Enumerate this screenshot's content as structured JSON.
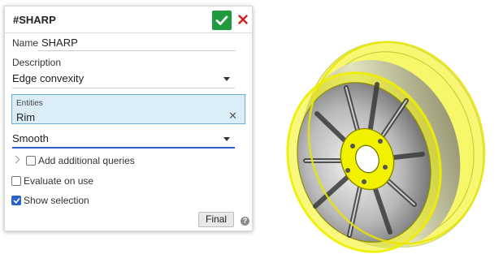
{
  "dialog": {
    "title": "#SHARP",
    "name_label": "Name",
    "name_value": "SHARP",
    "description_label": "Description",
    "description_value": "Edge convexity",
    "entities_label": "Entities",
    "entities_value": "Rim",
    "smooth_value": "Smooth",
    "add_queries_label": "Add additional queries",
    "add_queries_checked": false,
    "evaluate_label": "Evaluate on use",
    "evaluate_checked": false,
    "show_selection_label": "Show selection",
    "show_selection_checked": true,
    "final_label": "Final",
    "help_glyph": "?"
  },
  "colors": {
    "ok_green": "#1f9a3c",
    "cancel_red": "#d11f1f",
    "highlight_yellow": "#f2f200",
    "selection_blue": "#2a62c9",
    "entities_bg": "#dbeef8"
  },
  "icons": [
    "check-icon",
    "close-icon",
    "chevron-right-icon",
    "dropdown-caret-icon",
    "clear-icon",
    "help-icon"
  ]
}
